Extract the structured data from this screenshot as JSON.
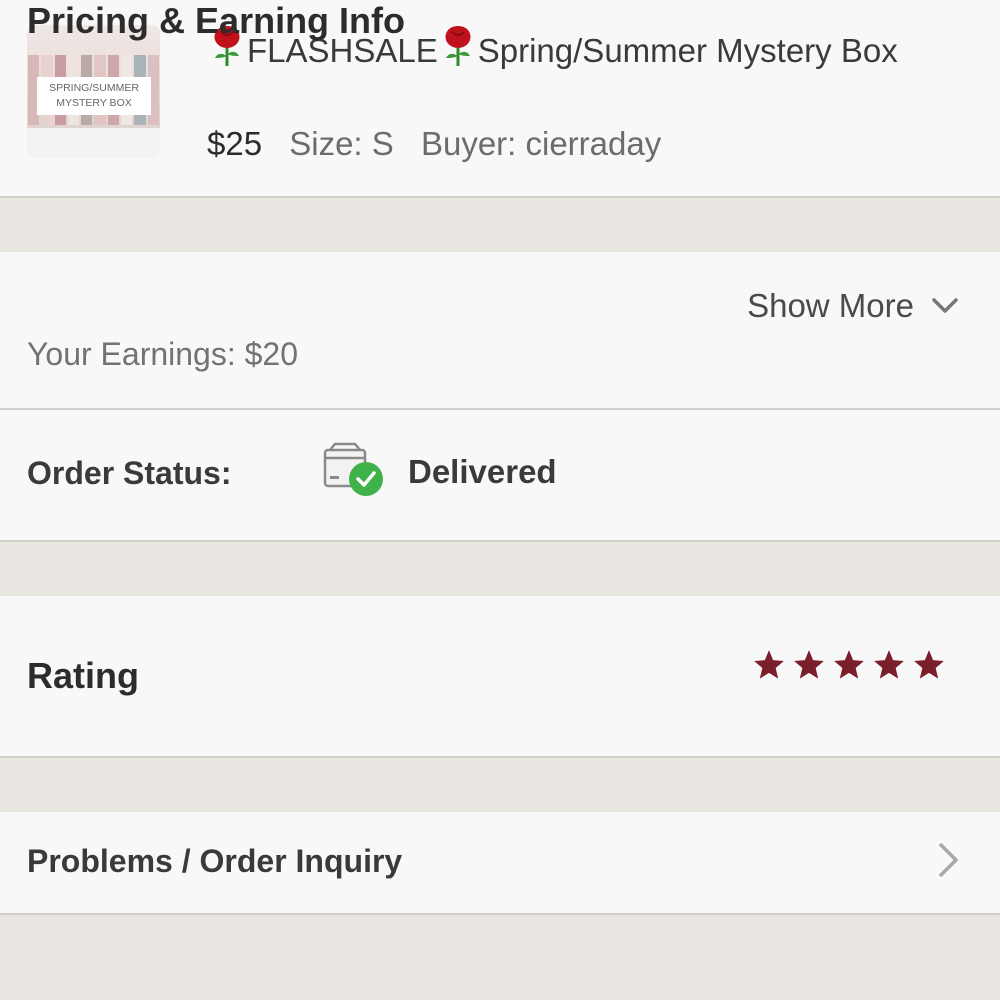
{
  "listing": {
    "thumbnail_label_line1": "SPRING/SUMMER",
    "thumbnail_label_line2": "MYSTERY BOX",
    "rose_icon": "rose-emoji",
    "title_part1": "FLASHSALE",
    "title_part2": "Spring/Summer Mystery Box",
    "price": "$25",
    "size": "Size: S",
    "buyer": "Buyer: cierraday"
  },
  "pricing": {
    "title": "Pricing & Earning Info",
    "earnings": "Your Earnings: $20",
    "show_more": "Show More"
  },
  "order_status": {
    "label": "Order Status:",
    "value": "Delivered",
    "status_color": "#3fb24a"
  },
  "rating": {
    "label": "Rating",
    "stars": 5,
    "max_stars": 5,
    "star_color": "#7a1f2b"
  },
  "problems": {
    "label": "Problems / Order Inquiry"
  }
}
